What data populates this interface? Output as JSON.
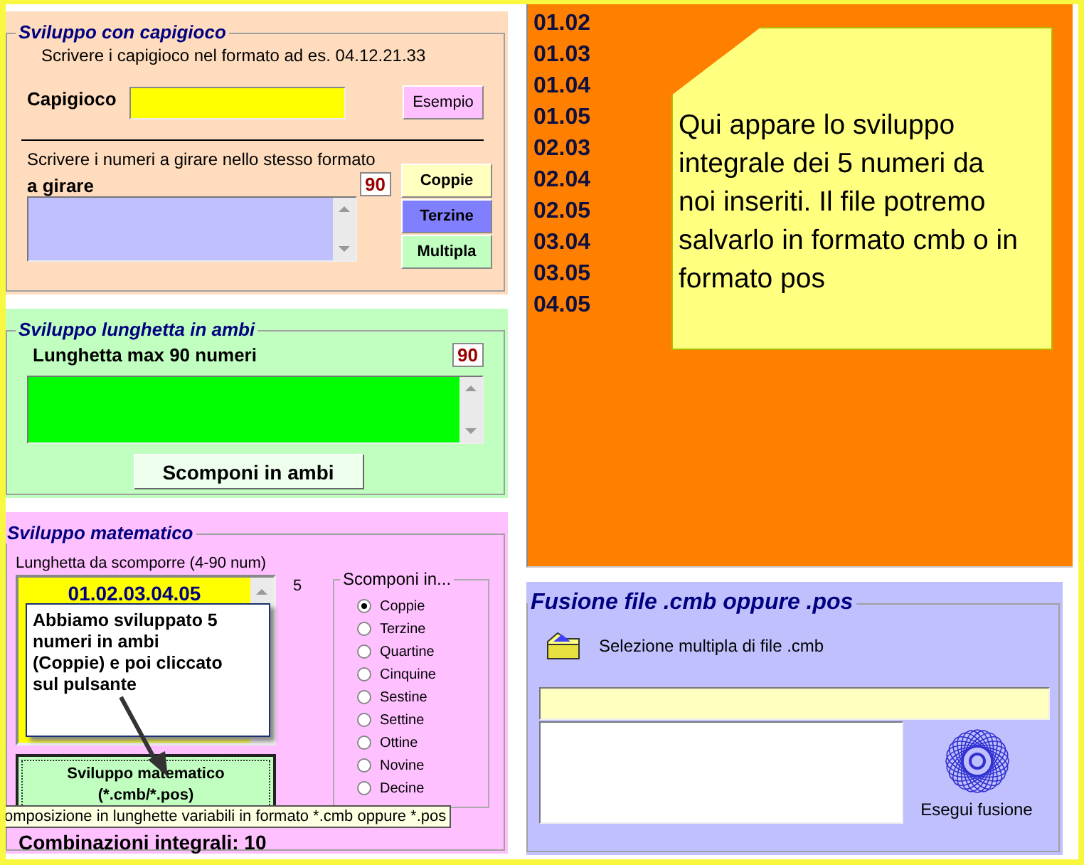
{
  "capigioco_section": {
    "legend": "Sviluppo con capigioco",
    "hint": "Scrivere i capigioco nel formato ad es. 04.12.21.33",
    "capigioco_label": "Capigioco",
    "example_button": "Esempio",
    "numbers_hint": "Scrivere i numeri a girare nello stesso formato",
    "girare_label": "a girare",
    "counter": "90",
    "type_buttons": [
      {
        "label": "Coppie",
        "color": "#ffffc0"
      },
      {
        "label": "Terzine",
        "color": "#8080ff"
      },
      {
        "label": "Multipla",
        "color": "#c0ffc0"
      }
    ]
  },
  "ambi_section": {
    "legend": "Sviluppo lunghetta in ambi",
    "label": "Lunghetta max 90 numeri",
    "counter": "90",
    "button": "Scomponi in ambi"
  },
  "math_section": {
    "legend": "Sviluppo matematico",
    "length_label": "Lunghetta da scomporre (4-90 num)",
    "list_items": [
      "01.02.03.04.05"
    ],
    "count": "5",
    "develop_button": [
      "Sviluppo matematico",
      "(*.cmb/*.pos)"
    ],
    "combinations": "Combinazioni integrali: 10",
    "split_group": {
      "legend": "Scomponi in...",
      "options": [
        {
          "label": "Coppie",
          "selected": true
        },
        {
          "label": "Terzine",
          "selected": false
        },
        {
          "label": "Quartine",
          "selected": false
        },
        {
          "label": "Cinquine",
          "selected": false
        },
        {
          "label": "Sestine",
          "selected": false
        },
        {
          "label": "Settine",
          "selected": false
        },
        {
          "label": "Ottine",
          "selected": false
        },
        {
          "label": "Novine",
          "selected": false
        },
        {
          "label": "Decine",
          "selected": false
        }
      ]
    }
  },
  "callout": {
    "text": "Abbiamo sviluppato 5 numeri in ambi (Coppie) e poi cliccato sul pulsante"
  },
  "tooltip": {
    "text": "omposizione in lunghette variabili in formato *.cmb oppure *.pos"
  },
  "results": {
    "items": [
      "01.02",
      "01.03",
      "01.04",
      "01.05",
      "02.03",
      "02.04",
      "02.05",
      "03.04",
      "03.05",
      "04.05"
    ]
  },
  "note": {
    "text": "Qui appare lo sviluppo integrale dei 5 numeri da noi inseriti. Il file potremo salvarlo in formato cmb o in formato pos"
  },
  "fusion_section": {
    "legend": "Fusione file .cmb oppure .pos",
    "select_label": "Selezione multipla di file .cmb",
    "merge_button": "Esegui fusione"
  }
}
